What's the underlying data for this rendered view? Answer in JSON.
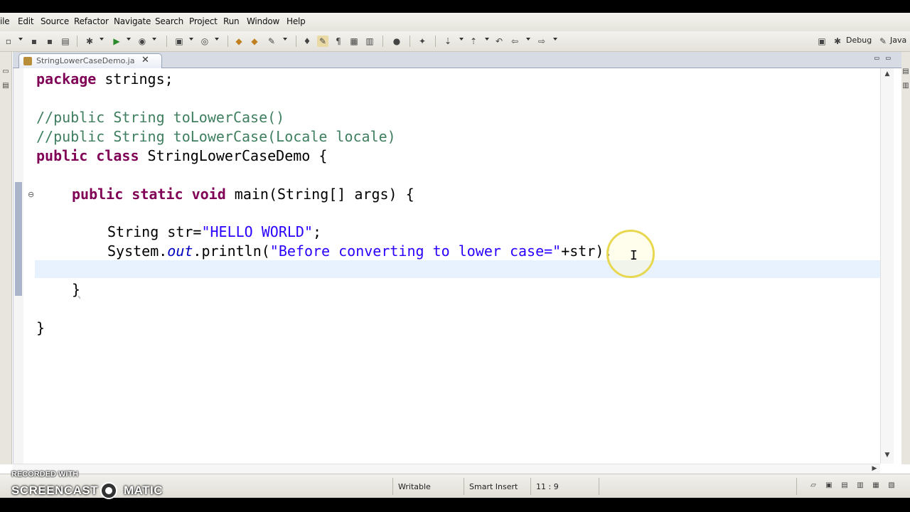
{
  "menu": {
    "items": [
      "ile",
      "Edit",
      "Source",
      "Refactor",
      "Navigate",
      "Search",
      "Project",
      "Run",
      "Window",
      "Help"
    ]
  },
  "toolbar": {
    "perspective_debug": "Debug",
    "perspective_java": "Java"
  },
  "editor_tab": {
    "label": "StringLowerCaseDemo.ja",
    "close": "✕",
    "minimize": "▭",
    "maximize": "▭"
  },
  "code": {
    "line1_kw": "package",
    "line1_rest": " strings;",
    "line3": "//public String toLowerCase()",
    "line4": "//public String toLowerCase(Locale locale)",
    "line5_kw": "public class",
    "line5_rest": " StringLowerCaseDemo {",
    "line7_kw": "public static void",
    "line7_rest": " main(String[] args) {",
    "line9_pre": "String str=",
    "line9_str": "\"HELLO WORLD\"",
    "line9_post": ";",
    "line10_pre": "System.",
    "line10_fld": "out",
    "line10_mid": ".println(",
    "line10_str": "\"Before converting to lower case=\"",
    "line10_post": "+str);",
    "line12": "}",
    "line14": "}"
  },
  "status": {
    "writable": "Writable",
    "insert_mode": "Smart Insert",
    "position": "11 : 9"
  },
  "watermark": {
    "recorded_with": "RECORDED WITH",
    "brand_left": "SCREENCAST",
    "brand_right": "MATIC"
  },
  "colors": {
    "keyword": "#7f0055",
    "comment": "#3f7f5f",
    "string": "#2a00ff",
    "field": "#0000c0",
    "current_line": "#e8f2fe"
  }
}
